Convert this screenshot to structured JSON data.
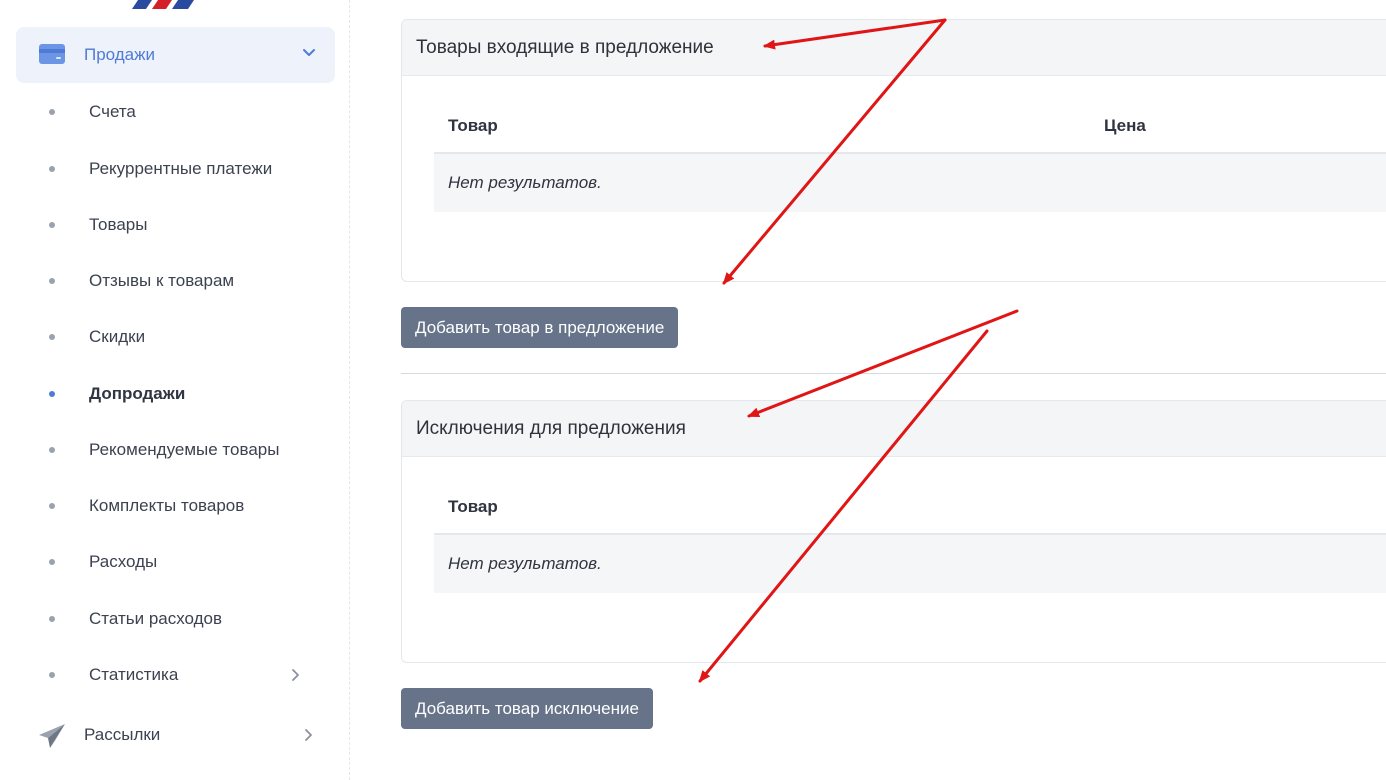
{
  "sidebar": {
    "parent_label": "Продажи",
    "items": [
      {
        "label": "Счета"
      },
      {
        "label": "Рекуррентные платежи"
      },
      {
        "label": "Товары"
      },
      {
        "label": "Отзывы к товарам"
      },
      {
        "label": "Скидки"
      },
      {
        "label": "Допродажи"
      },
      {
        "label": "Рекомендуемые товары"
      },
      {
        "label": "Комплекты товаров"
      },
      {
        "label": "Расходы"
      },
      {
        "label": "Статьи расходов"
      },
      {
        "label": "Статистика"
      }
    ],
    "root_label": "Рассылки"
  },
  "main": {
    "section1": {
      "title": "Товары входящие в предложение",
      "col_product": "Товар",
      "col_price": "Цена",
      "empty": "Нет результатов.",
      "button": "Добавить товар в предложение"
    },
    "section2": {
      "title": "Исключения для предложения",
      "col_product": "Товар",
      "empty": "Нет результатов.",
      "button": "Добавить товар исключение"
    }
  },
  "colors": {
    "accent": "#4f7ad6",
    "button": "#667389",
    "arrow": "#e01515"
  }
}
